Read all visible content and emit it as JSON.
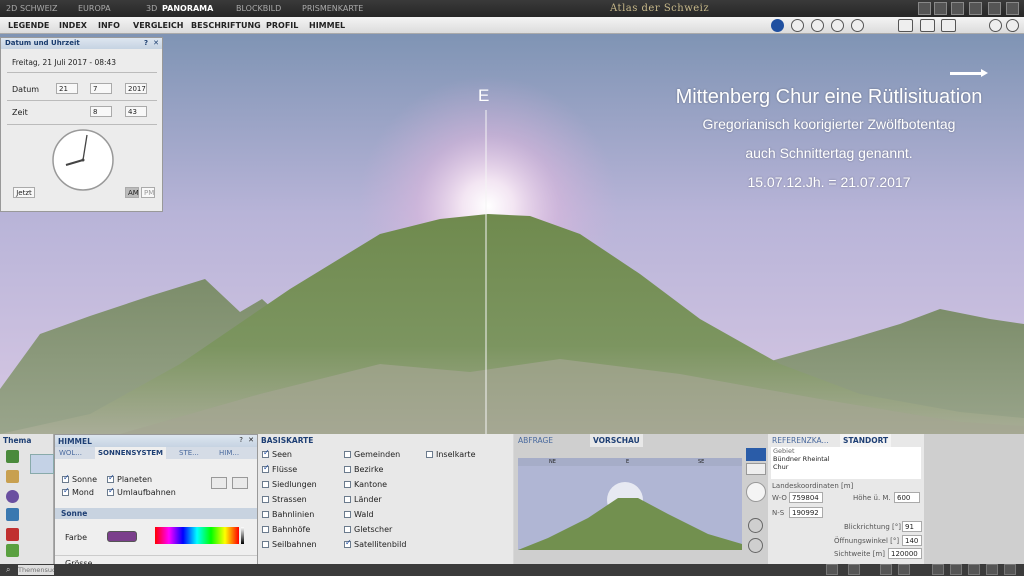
{
  "topbar": {
    "mode_2d": "2D",
    "schweiz": "SCHWEIZ",
    "europa": "EUROPA",
    "mode_3d": "3D",
    "panorama": "PANORAMA",
    "blockbild": "BLOCKBILD",
    "prismenkarte": "PRISMENKARTE",
    "atlas_title": "Atlas der Schweiz"
  },
  "menu": [
    "LEGENDE",
    "INDEX",
    "INFO",
    "VERGLEICH",
    "BESCHRIFTUNG",
    "PROFIL",
    "HIMMEL"
  ],
  "overlay": {
    "title": "Mittenberg Chur eine Rütlisituation",
    "line1": "Gregorianisch koorigierter Zwölfbotentag",
    "line2": "auch Schnittertag genannt.",
    "line3": "15.07.12.Jh. = 21.07.2017",
    "compass": "E"
  },
  "datepanel": {
    "title": "Datum und Uhrzeit",
    "help": "?",
    "close": "✕",
    "date_text": "Freitag, 21 Juli 2017 - 08:43",
    "datum_label": "Datum",
    "day": "21",
    "month": "7",
    "year": "2017",
    "zeit_label": "Zeit",
    "hour": "8",
    "minute": "43",
    "jetzt": "Jetzt",
    "am": "AM",
    "pm": "PM"
  },
  "thema": {
    "title": "Thema"
  },
  "himmel": {
    "title": "HIMMEL",
    "help": "?",
    "close": "✕",
    "tab_wo": "WOL...",
    "tab_sonnensystem": "SONNENSYSTEM",
    "tab_ste": "STE...",
    "tab_him": "HIM...",
    "sonne": "Sonne",
    "mond": "Mond",
    "planeten": "Planeten",
    "umlaufbahnen": "Umlaufbahnen",
    "section": "Sonne",
    "farbe": "Farbe",
    "groesse": "Grösse",
    "farbe_color": "#7b3f8c"
  },
  "basiskarte": {
    "title": "BASISKARTE",
    "col1": [
      {
        "label": "Seen",
        "on": true
      },
      {
        "label": "Flüsse",
        "on": true
      },
      {
        "label": "Siedlungen",
        "on": false
      },
      {
        "label": "Strassen",
        "on": false
      },
      {
        "label": "Bahnlinien",
        "on": false
      },
      {
        "label": "Bahnhöfe",
        "on": false
      },
      {
        "label": "Seilbahnen",
        "on": false
      }
    ],
    "col2": [
      {
        "label": "Gemeinden",
        "on": false
      },
      {
        "label": "Bezirke",
        "on": false
      },
      {
        "label": "Kantone",
        "on": false
      },
      {
        "label": "Länder",
        "on": false
      },
      {
        "label": "Wald",
        "on": false
      },
      {
        "label": "Gletscher",
        "on": false
      },
      {
        "label": "Satellitenbild",
        "on": true
      }
    ],
    "col3": [
      {
        "label": "Inselkarte",
        "on": false
      }
    ]
  },
  "vorschau": {
    "tab_abfrage": "ABFRAGE",
    "tab_vorschau": "VORSCHAU",
    "scale_left": "NE",
    "scale_mid": "E",
    "scale_right": "SE"
  },
  "standort": {
    "tab_referenz": "REFERENZKA...",
    "tab_standort": "STANDORT",
    "gebiet_label": "Gebiet",
    "gebiet_1": "Bündner Rheintal",
    "gebiet_2": "Chur",
    "lk_label": "Landeskoordinaten [m]",
    "wo_label": "W-O",
    "wo_value": "759804",
    "ns_label": "N-S",
    "ns_value": "190992",
    "hoehe_label": "Höhe ü. M.",
    "hoehe_value": "600",
    "blick_label": "Blickrichtung [°]",
    "blick_value": "91",
    "oeffnung_label": "Öffnungswinkel [°]",
    "oeffnung_value": "140",
    "sicht_label": "Sichtweite [m]",
    "sicht_value": "120000"
  },
  "status": {
    "search_placeholder": "Themensuche"
  }
}
